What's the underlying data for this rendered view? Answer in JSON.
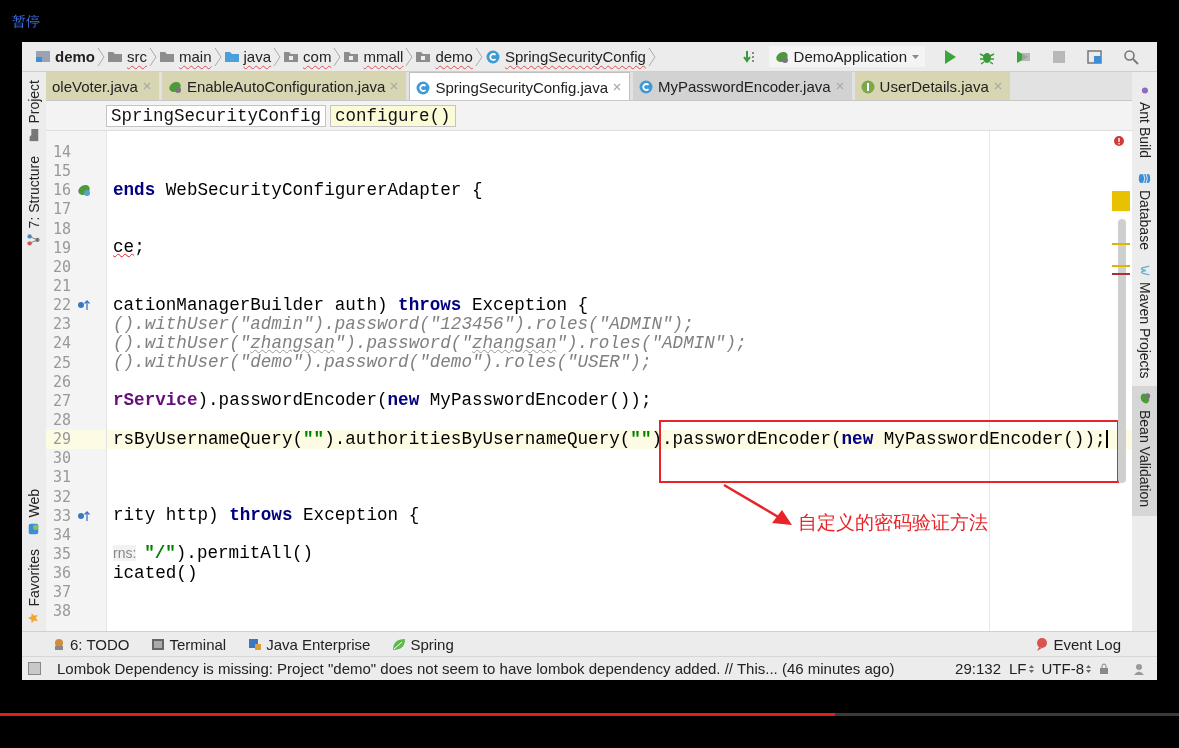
{
  "player": {
    "pause_label": "暂停",
    "progress": {
      "level": 0.708
    }
  },
  "navbar": {
    "breadcrumbs": [
      {
        "label": "demo",
        "kind": "module",
        "bold": true
      },
      {
        "label": "src",
        "kind": "folder",
        "bold": false
      },
      {
        "label": "main",
        "kind": "folder",
        "bold": false
      },
      {
        "label": "java",
        "kind": "source",
        "bold": false
      },
      {
        "label": "com",
        "kind": "package",
        "bold": false
      },
      {
        "label": "mmall",
        "kind": "package",
        "bold": false
      },
      {
        "label": "demo",
        "kind": "package",
        "bold": false
      },
      {
        "label": "SpringSecurityConfig",
        "kind": "class",
        "bold": false
      }
    ],
    "run_config": "DemoApplication"
  },
  "tabs": [
    {
      "label": "oleVoter.java",
      "selected": false,
      "color": "#d8d6b2",
      "kind": "plain"
    },
    {
      "label": "EnableAutoConfiguration.java",
      "selected": false,
      "color": "#d8d6b2",
      "kind": "bean"
    },
    {
      "label": "SpringSecurityConfig.java",
      "selected": true,
      "color": "#ffffff",
      "kind": "class"
    },
    {
      "label": "MyPasswordEncoder.java",
      "selected": false,
      "color": "#d2d2d2",
      "kind": "class"
    },
    {
      "label": "UserDetails.java",
      "selected": false,
      "color": "#d8d6b2",
      "kind": "interface"
    }
  ],
  "left_sidebar": {
    "top_items": [
      {
        "label": "Project",
        "kind": "project"
      },
      {
        "label": "7: Structure",
        "kind": "structure"
      }
    ],
    "bottom_items": [
      {
        "label": "Web",
        "kind": "web"
      },
      {
        "label": "Favorites",
        "kind": "star"
      }
    ]
  },
  "right_sidebar": {
    "items": [
      {
        "label": "Ant Build",
        "kind": "ant",
        "selected": false
      },
      {
        "label": "Database",
        "kind": "database",
        "selected": false
      },
      {
        "label": "Maven Projects",
        "kind": "maven",
        "selected": false
      },
      {
        "label": "Bean Validation",
        "kind": "bean",
        "selected": true
      }
    ]
  },
  "editor_breadcrumb": [
    {
      "label": "SpringSecurityConfig",
      "selected": false
    },
    {
      "label": "configure()",
      "selected": true
    }
  ],
  "editor": {
    "lines": [
      {
        "number": "14"
      },
      {
        "number": "15"
      },
      {
        "number": "16",
        "kind": "bean",
        "tokens": [
          {
            "kind": "keyword",
            "text": "ends"
          },
          {
            "kind": "plain",
            "text": " WebSecurityConfigurerAdapter {"
          }
        ]
      },
      {
        "number": "17"
      },
      {
        "number": "18"
      },
      {
        "number": "19",
        "tokens": [
          {
            "kind": "error",
            "text": "ce"
          },
          {
            "kind": "plain",
            "text": ";"
          }
        ]
      },
      {
        "number": "20"
      },
      {
        "number": "21"
      },
      {
        "number": "22",
        "kind": "override",
        "tokens": [
          {
            "kind": "plain",
            "text": "cationManagerBuilder auth) "
          },
          {
            "kind": "keyword",
            "text": "throws"
          },
          {
            "kind": "plain",
            "text": " Exception {"
          }
        ]
      },
      {
        "number": "23",
        "tokens": [
          {
            "kind": "comment",
            "text": "().withUser(\"admin\").password(\"123456\").roles(\"ADMIN\");"
          }
        ]
      },
      {
        "number": "24",
        "tokens": [
          {
            "kind": "comment",
            "text": "().withUser(\""
          },
          {
            "kind": "comment_typo",
            "text": "zhangsan"
          },
          {
            "kind": "comment",
            "text": "\").password(\""
          },
          {
            "kind": "comment_typo",
            "text": "zhangsan"
          },
          {
            "kind": "comment",
            "text": "\").roles(\"ADMIN\");"
          }
        ]
      },
      {
        "number": "25",
        "tokens": [
          {
            "kind": "comment",
            "text": "().withUser(\"demo\").password(\"demo\").roles(\"USER\");"
          }
        ]
      },
      {
        "number": "26"
      },
      {
        "number": "27",
        "tokens": [
          {
            "kind": "field",
            "text": "rService"
          },
          {
            "kind": "plain",
            "text": ").passwordEncoder("
          },
          {
            "kind": "keyword",
            "text": "new"
          },
          {
            "kind": "plain",
            "text": " MyPasswordEncoder());"
          }
        ]
      },
      {
        "number": "28"
      },
      {
        "number": "29",
        "highlighted": true,
        "tokens": [
          {
            "kind": "plain",
            "text": "rsByUsernameQuery("
          },
          {
            "kind": "string",
            "text": "\"\""
          },
          {
            "kind": "plain",
            "text": ").authoritiesByUsernameQuery("
          },
          {
            "kind": "string",
            "text": "\"\""
          },
          {
            "kind": "plain",
            "text": ").passwordEncoder("
          },
          {
            "kind": "keyword",
            "text": "new"
          },
          {
            "kind": "plain",
            "text": " MyPasswordEncoder());"
          }
        ]
      },
      {
        "number": "30"
      },
      {
        "number": "31"
      },
      {
        "number": "32"
      },
      {
        "number": "33",
        "kind": "override",
        "tokens": [
          {
            "kind": "plain",
            "text": "rity http) "
          },
          {
            "kind": "keyword",
            "text": "throws"
          },
          {
            "kind": "plain",
            "text": " Exception {"
          }
        ]
      },
      {
        "number": "34"
      },
      {
        "number": "35",
        "tokens": [
          {
            "kind": "hint",
            "text": "rns:"
          },
          {
            "kind": "string",
            "text": "\"/\""
          },
          {
            "kind": "plain",
            "text": ").permitAll()"
          }
        ]
      },
      {
        "number": "36",
        "tokens": [
          {
            "kind": "plain",
            "text": "icated()"
          }
        ]
      },
      {
        "number": "37"
      },
      {
        "number": "38"
      }
    ],
    "annotation": "自定义的密码验证方法"
  },
  "tool_windows": [
    {
      "label": "6: TODO",
      "kind": "todo"
    },
    {
      "label": "Terminal",
      "kind": "terminal"
    },
    {
      "label": "Java Enterprise",
      "kind": "enterprise"
    },
    {
      "label": "Spring",
      "kind": "spring"
    }
  ],
  "event_log": "Event Log",
  "status_bar": {
    "message": "Lombok Dependency is missing: Project \"demo\" does not seem to have lombok dependency added. // This... (46 minutes ago)",
    "position": "29:132",
    "line_separator": "LF",
    "encoding": "UTF-8"
  }
}
